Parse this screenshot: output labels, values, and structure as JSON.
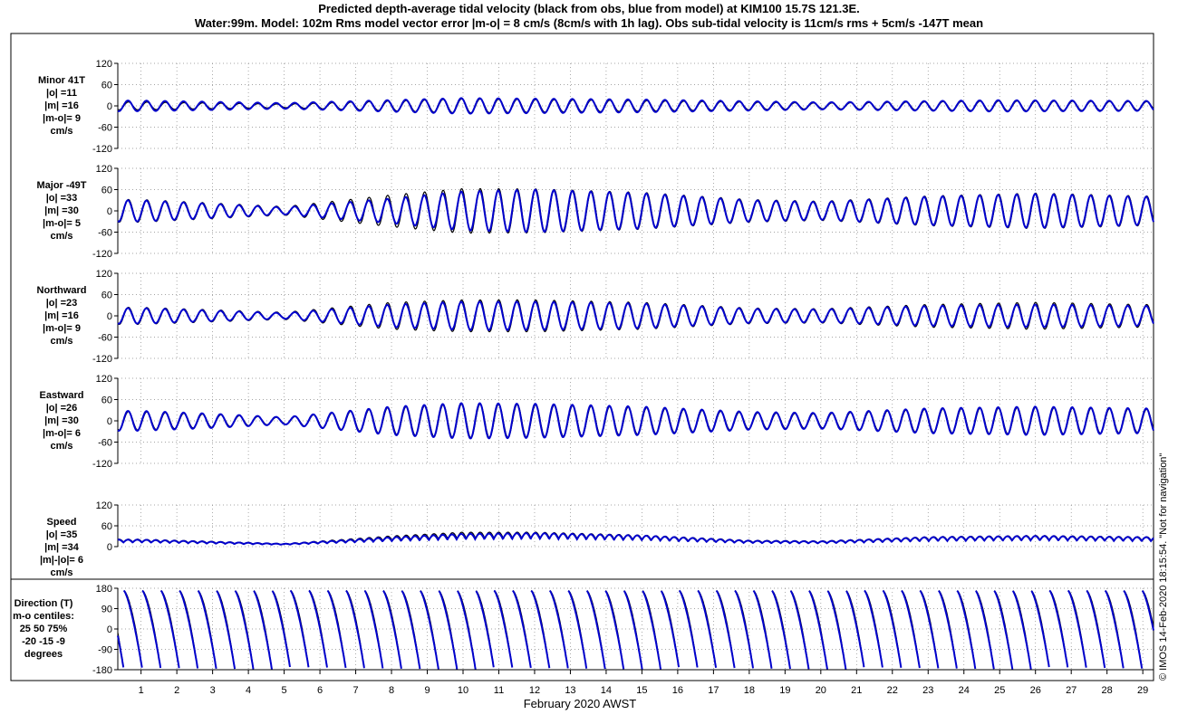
{
  "title_line1": "Predicted depth-average tidal velocity (black from obs, blue from model) at KIM100 15.7S 121.3E.",
  "title_line2": "Water:99m. Model: 102m  Rms model vector error |m-o| = 8 cm/s (8cm/s with 1h lag). Obs sub-tidal velocity is 11cm/s rms + 5cm/s -147T mean",
  "side_note": "© IMOS 14-Feb-2020 18:15:54. \"Not for navigation\"",
  "colors": {
    "obs": "#000000",
    "model": "#0000cc",
    "grid": "#888888",
    "frame": "#000000"
  },
  "chart_data": {
    "type": "line",
    "xlabel": "February 2020 AWST",
    "x_ticks": [
      "1",
      "2",
      "3",
      "4",
      "5",
      "6",
      "7",
      "8",
      "9",
      "10",
      "11",
      "12",
      "13",
      "14",
      "15",
      "16",
      "17",
      "18",
      "19",
      "20",
      "21",
      "22",
      "23",
      "24",
      "25",
      "26",
      "27",
      "28",
      "29"
    ],
    "xlim": [
      0.35,
      29.3
    ],
    "series_legend": {
      "obs": "black from obs",
      "model": "blue from model"
    },
    "panels": [
      {
        "id": "minor",
        "labels": [
          "Minor 41T",
          "|o| =11",
          "|m| =16",
          "|m-o|= 9",
          "cm/s"
        ],
        "ylim": [
          -120,
          120
        ],
        "yticks": [
          "120",
          "60",
          "0",
          "-60",
          "-120"
        ],
        "wave": {
          "kind": "signed",
          "period_days": 0.5175,
          "days": [
            1,
            5,
            10,
            15,
            20,
            25,
            29
          ],
          "model_amp": [
            15,
            8,
            22,
            18,
            10,
            16,
            14
          ],
          "obs_amp": [
            11,
            5,
            20,
            15,
            8,
            14,
            12
          ]
        }
      },
      {
        "id": "major",
        "labels": [
          "Major -49T",
          "|o| =33",
          "|m| =30",
          "|m-o|= 5",
          "cm/s"
        ],
        "ylim": [
          -120,
          120
        ],
        "yticks": [
          "120",
          "60",
          "0",
          "-60",
          "-120"
        ],
        "wave": {
          "kind": "signed",
          "period_days": 0.5175,
          "days": [
            1,
            3,
            5,
            8,
            10,
            12,
            15,
            18,
            20,
            23,
            26,
            29
          ],
          "model_amp": [
            30,
            20,
            10,
            35,
            55,
            60,
            50,
            30,
            25,
            40,
            48,
            40
          ],
          "obs_amp": [
            32,
            22,
            12,
            45,
            63,
            62,
            52,
            32,
            27,
            42,
            50,
            42
          ]
        }
      },
      {
        "id": "northward",
        "labels": [
          "Northward",
          "|o| =23",
          "|m| =16",
          "|m-o|= 9",
          "cm/s"
        ],
        "ylim": [
          -120,
          120
        ],
        "yticks": [
          "120",
          "60",
          "0",
          "-60",
          "-120"
        ],
        "wave": {
          "kind": "signed",
          "period_days": 0.5175,
          "days": [
            1,
            3,
            5,
            8,
            10,
            12,
            15,
            18,
            20,
            23,
            26,
            29
          ],
          "model_amp": [
            22,
            15,
            8,
            32,
            40,
            40,
            35,
            20,
            18,
            28,
            32,
            28
          ],
          "obs_amp": [
            24,
            17,
            10,
            38,
            45,
            45,
            38,
            22,
            20,
            32,
            38,
            32
          ]
        }
      },
      {
        "id": "eastward",
        "labels": [
          "Eastward",
          "|o| =26",
          "|m| =30",
          "|m-o|= 6",
          "cm/s"
        ],
        "ylim": [
          -120,
          120
        ],
        "yticks": [
          "120",
          "60",
          "0",
          "-60",
          "-120"
        ],
        "wave": {
          "kind": "signed",
          "period_days": 0.5175,
          "days": [
            1,
            3,
            5,
            8,
            10,
            12,
            15,
            18,
            20,
            23,
            26,
            29
          ],
          "model_amp": [
            28,
            20,
            10,
            40,
            50,
            48,
            40,
            25,
            22,
            35,
            40,
            35
          ],
          "obs_amp": [
            26,
            18,
            9,
            38,
            48,
            46,
            38,
            23,
            20,
            33,
            38,
            33
          ]
        }
      },
      {
        "id": "speed",
        "labels": [
          "Speed",
          "|o| =35",
          "|m| =34",
          "|m|-|o|= 6",
          "cm/s"
        ],
        "ylim": [
          0,
          120
        ],
        "yticks": [
          "120",
          "60",
          "0"
        ],
        "wave": {
          "kind": "speed",
          "period_days": 0.5175,
          "days": [
            1,
            3,
            5,
            8,
            10,
            12,
            15,
            18,
            20,
            23,
            26,
            29
          ],
          "model_amp": [
            30,
            20,
            10,
            42,
            58,
            62,
            50,
            25,
            22,
            42,
            48,
            42
          ],
          "obs_amp": [
            32,
            22,
            11,
            48,
            66,
            66,
            52,
            27,
            24,
            44,
            50,
            44
          ]
        }
      },
      {
        "id": "direction",
        "labels": [
          "Direction (T)",
          "m-o centiles:",
          "25  50  75%",
          "-20  -15  -9",
          "degrees"
        ],
        "ylim": [
          -180,
          180
        ],
        "yticks": [
          "180",
          "90",
          "0",
          "-90",
          "-180"
        ],
        "wave": {
          "kind": "direction",
          "period_days": 0.5175,
          "model_offset_deg": -15
        }
      }
    ]
  }
}
